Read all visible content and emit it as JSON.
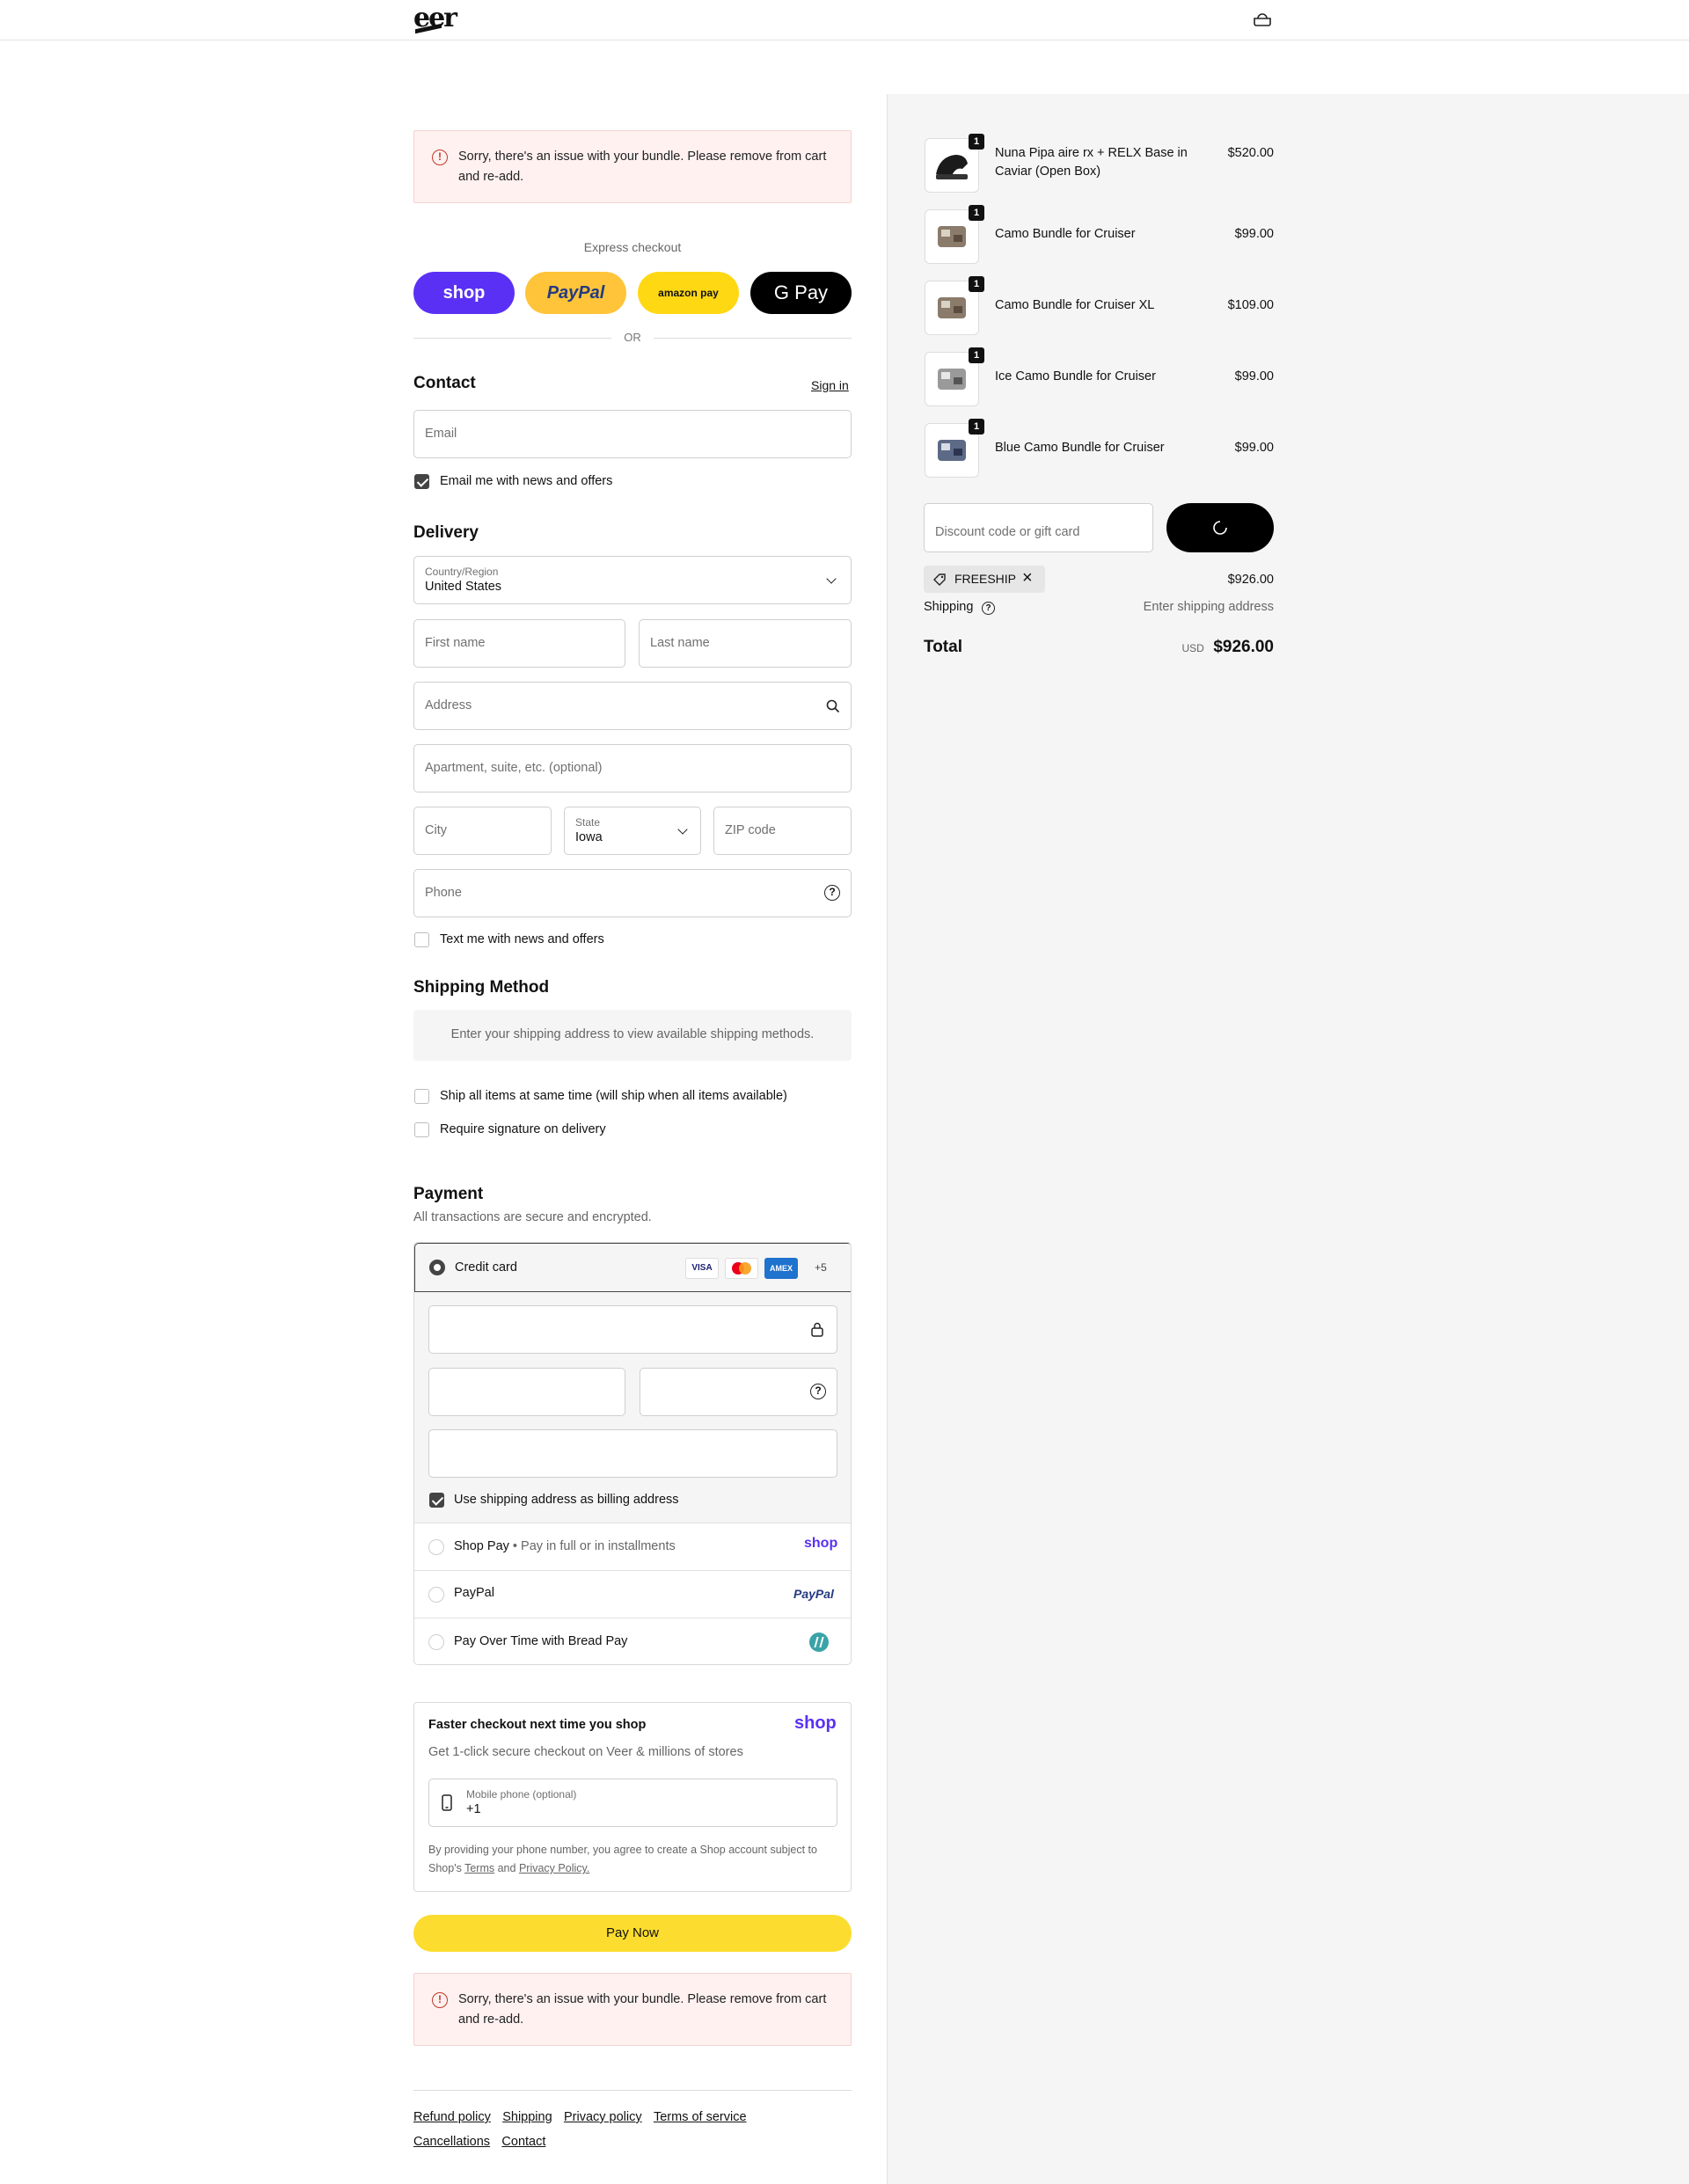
{
  "header": {
    "logo": "eer",
    "cart_icon": "bag-icon"
  },
  "alerts": {
    "top": "Sorry, there's an issue with your bundle. Please remove from cart and re-add.",
    "bottom": "Sorry, there's an issue with your bundle. Please remove from cart and re-add."
  },
  "express": {
    "title": "Express checkout",
    "shop": "shop",
    "paypal": "PayPal",
    "amazon": "amazon pay",
    "gpay": "G Pay",
    "or": "OR"
  },
  "contact": {
    "title": "Contact",
    "sign_in": "Sign in",
    "email_placeholder": "Email",
    "news_label": "Email me with news and offers",
    "news_checked": true
  },
  "delivery": {
    "title": "Delivery",
    "country_label": "Country/Region",
    "country_value": "United States",
    "first_name": "First name",
    "last_name": "Last name",
    "address": "Address",
    "apartment": "Apartment, suite, etc. (optional)",
    "city": "City",
    "state_label": "State",
    "state_value": "Iowa",
    "zip": "ZIP code",
    "phone": "Phone",
    "text_label": "Text me with news and offers",
    "text_checked": false
  },
  "shipping_method": {
    "title": "Shipping Method",
    "notice": "Enter your shipping address to view available shipping methods.",
    "ship_all": "Ship all items at same time (will ship when all items available)",
    "signature": "Require signature on delivery"
  },
  "payment": {
    "title": "Payment",
    "subtitle": "All transactions are secure and encrypted.",
    "credit_card": "Credit card",
    "cards": [
      "VISA",
      "MC",
      "AMEX",
      "+5"
    ],
    "billing_label": "Use shipping address as billing address",
    "shop_pay": "Shop Pay",
    "shop_pay_sub": "Pay in full or in installments",
    "shop_logo": "shop",
    "paypal": "PayPal",
    "paypal_logo": "PayPal",
    "bread": "Pay Over Time with Bread Pay"
  },
  "faster": {
    "title": "Faster checkout next time you shop",
    "logo": "shop",
    "subtitle": "Get 1-click secure checkout on Veer & millions of stores",
    "phone_label": "Mobile phone (optional)",
    "phone_value": "+1",
    "legal_prefix": "By providing your phone number, you agree to create a Shop account subject to Shop's",
    "terms": "Terms",
    "and": "and",
    "privacy": "Privacy Policy."
  },
  "pay_now": "Pay Now",
  "footer": {
    "links": [
      "Refund policy",
      "Shipping",
      "Privacy policy",
      "Terms of service",
      "Cancellations",
      "Contact"
    ]
  },
  "cart": {
    "items": [
      {
        "name": "Nuna Pipa aire rx + RELX Base in Caviar (Open Box)",
        "price": "$520.00",
        "qty": "1"
      },
      {
        "name": "Camo Bundle for Cruiser",
        "price": "$99.00",
        "qty": "1"
      },
      {
        "name": "Camo Bundle for Cruiser XL",
        "price": "$109.00",
        "qty": "1"
      },
      {
        "name": "Ice Camo Bundle for Cruiser",
        "price": "$99.00",
        "qty": "1"
      },
      {
        "name": "Blue Camo Bundle for Cruiser",
        "price": "$99.00",
        "qty": "1"
      }
    ],
    "discount_placeholder": "Discount code or gift card",
    "code": "FREESHIP",
    "subtotal": "$926.00",
    "shipping_label": "Shipping",
    "shipping_value": "Enter shipping address",
    "total_label": "Total",
    "currency": "USD",
    "total": "$926.00"
  }
}
